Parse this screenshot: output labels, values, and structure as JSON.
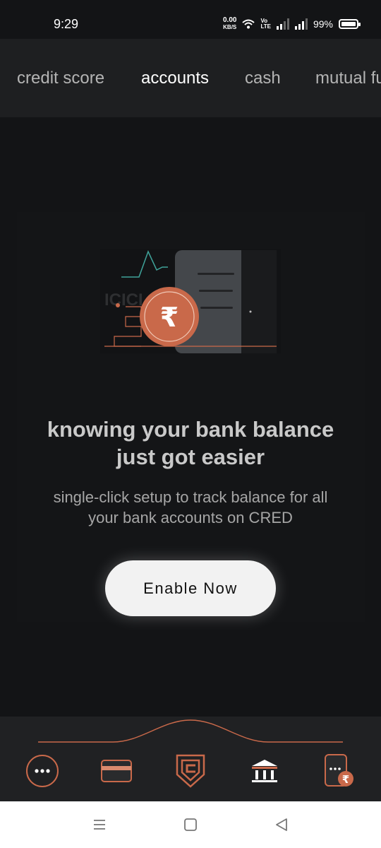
{
  "status_bar": {
    "time": "9:29",
    "net_speed_value": "0.00",
    "net_speed_unit": "KB/S",
    "volte_line1": "Vo",
    "volte_line2": "LTE",
    "battery_percent": "99%"
  },
  "tabs": [
    {
      "label": "credit score",
      "active": false
    },
    {
      "label": "accounts",
      "active": true
    },
    {
      "label": "cash",
      "active": false
    },
    {
      "label": "mutual fu",
      "active": false
    }
  ],
  "main": {
    "illustration_bank_text": "ICICI",
    "illustration_icon": "rupee-icon",
    "headline_line1": "knowing your bank balance",
    "headline_line2": "just got easier",
    "subline_line1": "single-click setup to track balance for all",
    "subline_line2": "your bank accounts on CRED",
    "enable_button_label": "Enable Now"
  },
  "bottom_nav": {
    "items": [
      {
        "icon": "more-dots-icon"
      },
      {
        "icon": "card-icon"
      },
      {
        "icon": "cred-logo-icon"
      },
      {
        "icon": "bank-icon"
      },
      {
        "icon": "phone-rupee-icon"
      }
    ]
  },
  "system_nav": {
    "buttons": [
      {
        "icon": "recents-icon"
      },
      {
        "icon": "home-icon"
      },
      {
        "icon": "back-icon"
      }
    ]
  },
  "colors": {
    "background": "#131416",
    "tab_bar": "#1e1f21",
    "accent_copper": "#c9694a",
    "button_bg": "#f2f2f2"
  }
}
